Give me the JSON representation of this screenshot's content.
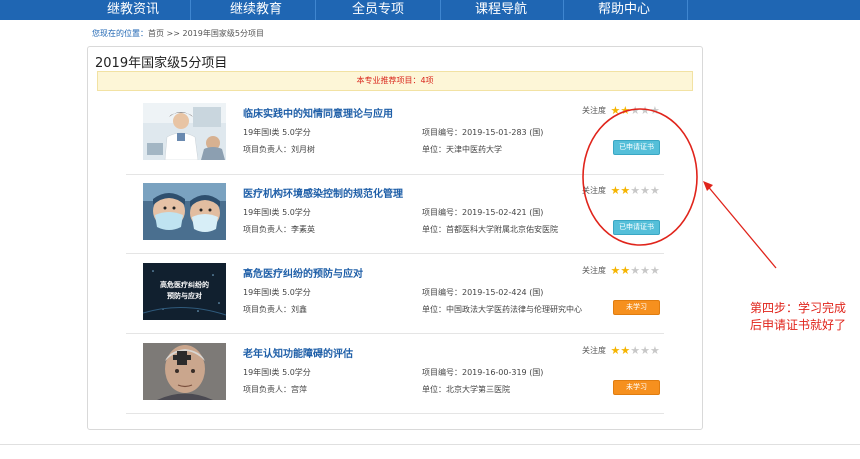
{
  "nav": {
    "items": [
      "继教资讯",
      "继续教育",
      "全员专项",
      "课程导航",
      "帮助中心"
    ]
  },
  "breadcrumb": {
    "label": "您现在的位置：",
    "home": "首页",
    "separator": ">>",
    "current": "2019年国家级5分项目"
  },
  "panel": {
    "title": "2019年国家级5分项目",
    "notice": "本专业推荐项目：4项"
  },
  "courses": [
    {
      "title": "临床实践中的知情同意理论与应用",
      "credit": "19年国I类 5.0学分",
      "leader": "项目负责人：刘月树",
      "code": "项目编号：2019-15-01-283 (国)",
      "unit": "单位：天津中医药大学",
      "focus_label": "关注度",
      "stars": 2,
      "stars_max": 5,
      "status": "已申请证书",
      "thumb_icon": "doctor-photo-icon"
    },
    {
      "title": "医疗机构环境感染控制的规范化管理",
      "credit": "19年国I类 5.0学分",
      "leader": "项目负责人：李素英",
      "code": "项目编号：2019-15-02-421 (国)",
      "unit": "单位：首都医科大学附属北京佑安医院",
      "focus_label": "关注度",
      "stars": 2,
      "stars_max": 5,
      "status": "已申请证书",
      "thumb_icon": "masked-nurses-photo-icon"
    },
    {
      "title": "高危医疗纠纷的预防与应对",
      "credit": "19年国I类 5.0学分",
      "leader": "项目负责人：刘鑫",
      "code": "项目编号：2019-15-02-424 (国)",
      "unit": "单位：中国政法大学医药法律与伦理研究中心",
      "focus_label": "关注度",
      "stars": 2,
      "stars_max": 5,
      "status": "未学习",
      "thumb_text": "高危医疗纠纷的\n预防与应对"
    },
    {
      "title": "老年认知功能障碍的评估",
      "credit": "19年国I类 5.0学分",
      "leader": "项目负责人：宫萍",
      "code": "项目编号：2019-16-00-319 (国)",
      "unit": "单位：北京大学第三医院",
      "focus_label": "关注度",
      "stars": 2,
      "stars_max": 5,
      "status": "未学习",
      "thumb_icon": "elderly-man-photo-icon"
    }
  ],
  "annotation": "第四步：学习完成后申请证书就好了",
  "colors": {
    "nav_bg": "#1f66b3",
    "title_blue": "#1f5fa8",
    "applied_btn": "#55bfd9",
    "unlearned_btn": "#f6901e",
    "annotation_red": "#e0241b"
  }
}
